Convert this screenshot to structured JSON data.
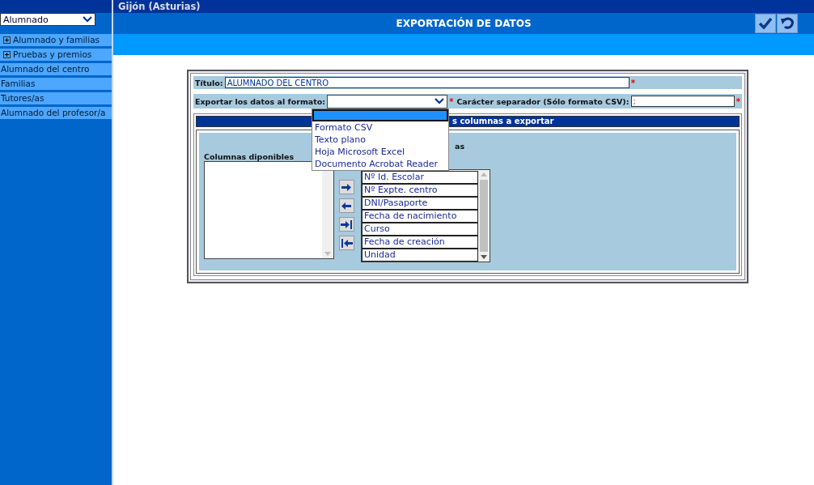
{
  "header": {
    "location": "Gijón (Asturias)"
  },
  "sidebar": {
    "profile_select": {
      "value": "Alumnado"
    },
    "items": [
      {
        "label": "Alumnado y familias",
        "kind": "group",
        "expanded": false
      },
      {
        "label": "Pruebas y premios",
        "kind": "group",
        "expanded": false
      },
      {
        "label": "Alumnado del centro",
        "kind": "link"
      },
      {
        "label": "Familias",
        "kind": "link"
      },
      {
        "label": "Tutores/as",
        "kind": "link"
      },
      {
        "label": "Alumnado del profesor/a",
        "kind": "link"
      }
    ]
  },
  "page": {
    "title": "EXPORTACIÓN DE DATOS"
  },
  "form": {
    "title_label": "Título:",
    "title_value": "ALUMNADO DEL CENTRO",
    "required_mark": "*",
    "format_label": "Exportar los datos al formato:",
    "format_options": [
      {
        "selected": true
      },
      {
        "label": "Formato CSV",
        "selected": false
      },
      {
        "label": "Texto plano",
        "selected": false
      },
      {
        "label": "Hoja Microsoft Excel",
        "selected": false
      },
      {
        "label": "Documento Acrobat Reader",
        "selected": false
      }
    ],
    "separator_label": "Carácter separador (Sólo formato CSV):",
    "separator_value": ";",
    "columns_heading": "s columnas a exportar",
    "available_label": "Columnas diponibles",
    "selected_label": "as",
    "selected_columns": [
      "Nº Id. Escolar",
      "Nº Expte. centro",
      "DNI/Pasaporte",
      "Fecha de nacimiento",
      "Curso",
      "Fecha de creación",
      "Unidad"
    ]
  }
}
